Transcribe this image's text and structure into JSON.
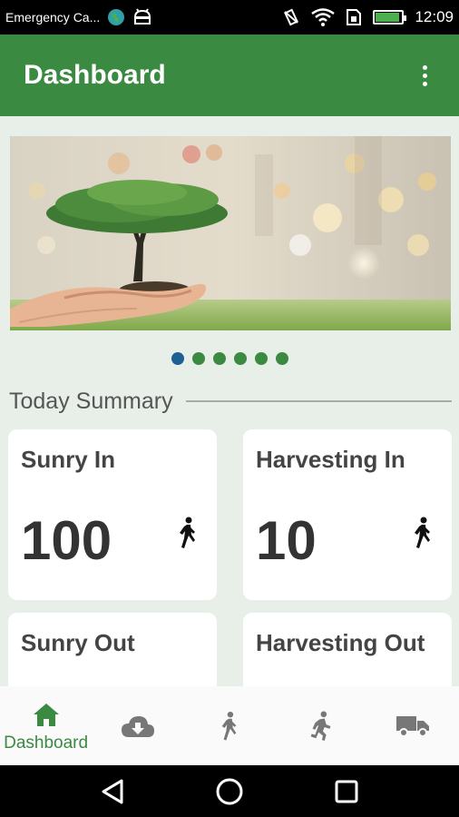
{
  "status_bar": {
    "carrier": "Emergency Ca...",
    "time": "12:09",
    "battery_level": 0.9
  },
  "app_bar": {
    "title": "Dashboard",
    "menu_icon": "more-vert-icon"
  },
  "carousel": {
    "page_count": 6,
    "active_index": 0
  },
  "summary": {
    "title": "Today Summary",
    "cards": [
      {
        "title": "Sunry In",
        "value": "100",
        "icon": "walking-person-icon"
      },
      {
        "title": "Harvesting In",
        "value": "10",
        "icon": "walking-person-icon"
      },
      {
        "title": "Sunry Out",
        "value": "",
        "icon": ""
      },
      {
        "title": "Harvesting Out",
        "value": "",
        "icon": ""
      }
    ]
  },
  "bottom_nav": {
    "items": [
      {
        "label": "Dashboard",
        "icon": "home-icon",
        "active": true
      },
      {
        "label": "",
        "icon": "cloud-download-icon",
        "active": false
      },
      {
        "label": "",
        "icon": "walking-person-icon",
        "active": false
      },
      {
        "label": "",
        "icon": "running-person-icon",
        "active": false
      },
      {
        "label": "",
        "icon": "truck-icon",
        "active": false
      }
    ]
  },
  "colors": {
    "primary": "#3a8a41",
    "active_dot": "#1e5f96",
    "background": "#e8efe9"
  }
}
